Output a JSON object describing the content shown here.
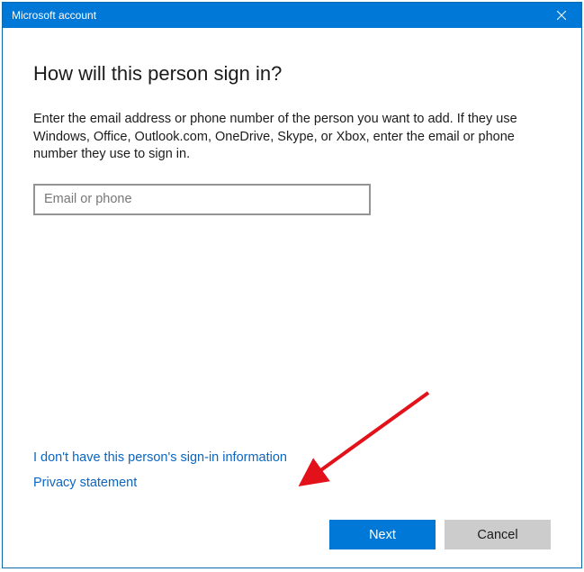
{
  "titlebar": {
    "title": "Microsoft account"
  },
  "main": {
    "heading": "How will this person sign in?",
    "description": "Enter the email address or phone number of the person you want to add. If they use Windows, Office, Outlook.com, OneDrive, Skype, or Xbox, enter the email or phone number they use to sign in.",
    "input_placeholder": "Email or phone",
    "input_value": ""
  },
  "links": {
    "no_signin": "I don't have this person's sign-in information",
    "privacy": "Privacy statement"
  },
  "buttons": {
    "next": "Next",
    "cancel": "Cancel"
  }
}
